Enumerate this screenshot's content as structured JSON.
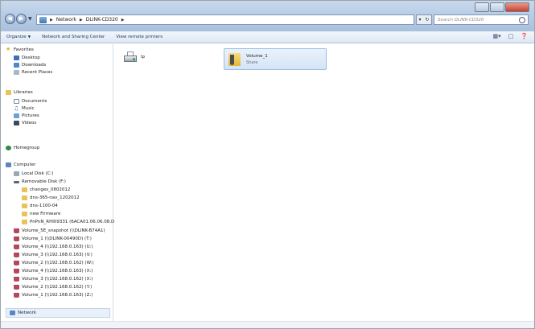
{
  "window": {
    "address_crumbs": [
      "Network",
      "DLINK-CD320"
    ],
    "search_placeholder": "Search DLINK-CD320"
  },
  "toolbar": {
    "organize": "Organize",
    "network_sharing": "Network and Sharing Center",
    "view_printers": "View remote printers"
  },
  "nav": {
    "favorites": "Favorites",
    "desktop": "Desktop",
    "downloads": "Downloads",
    "recent": "Recent Places",
    "libraries": "Libraries",
    "documents": "Documents",
    "music": "Music",
    "pictures": "Pictures",
    "videos": "Videos",
    "homegroup": "Homegroup",
    "computer": "Computer",
    "local_disk": "Local Disk (C:)",
    "removable": "Removable Disk (F:)",
    "folders": [
      "changes_0802012",
      "dns-365-nav_1202012",
      "dns-1100-04",
      "new Firmware",
      "PnPnN_RHI09331 (6ACA01.06.06.08.DNS)"
    ],
    "drives": [
      "Volume_5E_snapshot (\\\\DLINK-B74A1)",
      "Volume_1 (\\\\DLINK-00490D) (T:)",
      "Volume_4 (\\\\192.168.0.163) (U:)",
      "Volume_3 (\\\\192.168.0.163) (V:)",
      "Volume_2 (\\\\192.168.0.162) (W:)",
      "Volume_4 (\\\\192.168.0.163) (X:)",
      "Volume_3 (\\\\192.168.0.162) (X:)",
      "Volume_2 (\\\\192.168.0.162) (Y:)",
      "Volume_1 (\\\\192.168.0.163) (Z:)"
    ],
    "network": "Network"
  },
  "content": {
    "printer_label": "lp",
    "share_name": "Volume_1",
    "share_type": "Share"
  }
}
